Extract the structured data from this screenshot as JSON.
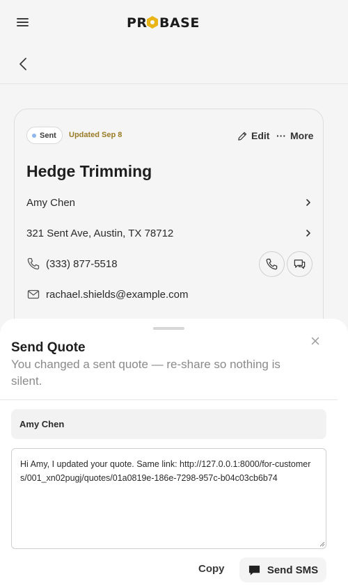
{
  "header": {
    "logo_text": "PROBASE",
    "logo_color": "#E8B416"
  },
  "quote_card": {
    "status": "Sent",
    "status_dot_color": "#8FB6EE",
    "updated": "Updated Sep 8",
    "edit_label": "Edit",
    "more_label": "More",
    "title": "Hedge Trimming",
    "customer_name": "Amy Chen",
    "address": "321 Sent Ave, Austin, TX 78712",
    "phone": "(333) 877-5518",
    "email": "rachael.shields@example.com"
  },
  "send_sheet": {
    "title": "Send Quote",
    "subtitle": "You changed a sent quote — re-share so nothing is silent.",
    "recipient": "Amy Chen",
    "message": "Hi Amy, I updated your quote. Same link: http://127.0.0.1:8000/for-customers/001_xn02pugj/quotes/01a0819e-186e-7298-957c-b04c03cb6b74",
    "copy_label": "Copy",
    "send_label": "Send SMS"
  }
}
